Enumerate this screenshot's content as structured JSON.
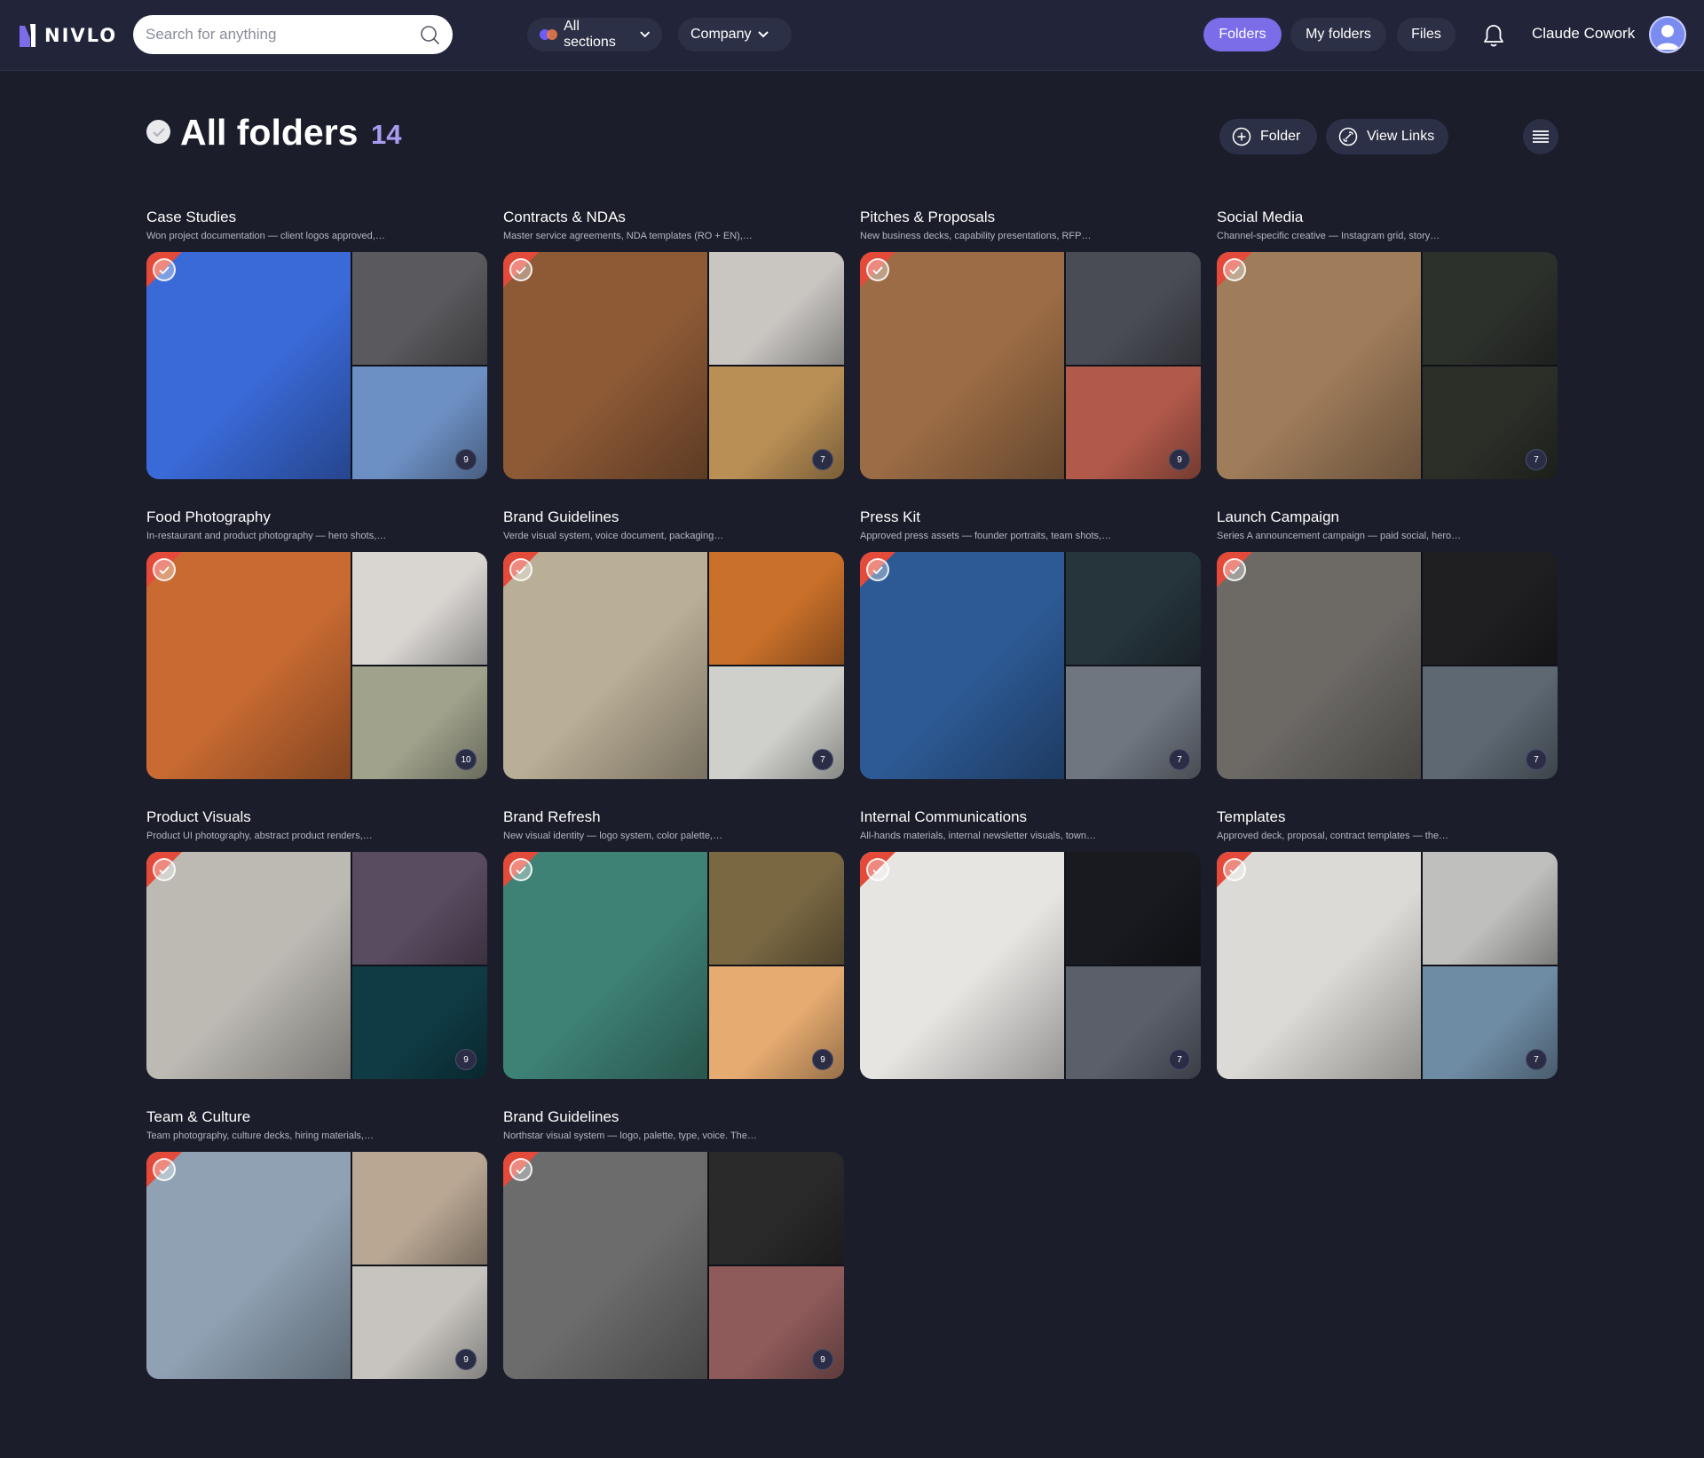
{
  "brand": {
    "name": "NIVLO"
  },
  "search": {
    "placeholder": "Search for anything"
  },
  "filters": {
    "sections": "All sections",
    "company": "Company"
  },
  "nav": {
    "folders": "Folders",
    "my_folders": "My folders",
    "files": "Files"
  },
  "user": {
    "name": "Claude Cowork"
  },
  "page": {
    "title": "All folders",
    "count": "14"
  },
  "actions": {
    "folder": "Folder",
    "view_links": "View Links"
  },
  "folders": [
    {
      "title": "Case Studies",
      "desc": "Won project documentation — client logos approved,…",
      "count": "9",
      "colors": [
        "#3a6ad8",
        "#5a5a5e",
        "#6d90c4"
      ]
    },
    {
      "title": "Contracts & NDAs",
      "desc": "Master service agreements, NDA templates (RO + EN),…",
      "count": "7",
      "colors": [
        "#8e5a36",
        "#c9c6c2",
        "#b98f55"
      ]
    },
    {
      "title": "Pitches & Proposals",
      "desc": "New business decks, capability presentations, RFP…",
      "count": "9",
      "colors": [
        "#9b6c45",
        "#4a4c55",
        "#b25a4a"
      ]
    },
    {
      "title": "Social Media",
      "desc": "Channel-specific creative — Instagram grid, story…",
      "count": "7",
      "colors": [
        "#9f7c5a",
        "#2d312c",
        "#2b2f28"
      ]
    },
    {
      "title": "Food Photography",
      "desc": "In-restaurant and product photography — hero shots,…",
      "count": "10",
      "colors": [
        "#c86a32",
        "#d9d6d2",
        "#a0a28c"
      ]
    },
    {
      "title": "Brand Guidelines",
      "desc": "Verde visual system, voice document, packaging…",
      "count": "7",
      "colors": [
        "#b9ae96",
        "#c9702a",
        "#cfcfcb"
      ]
    },
    {
      "title": "Press Kit",
      "desc": "Approved press assets — founder portraits, team shots,…",
      "count": "7",
      "colors": [
        "#2d5a95",
        "#26343c",
        "#6f7680"
      ]
    },
    {
      "title": "Launch Campaign",
      "desc": "Series A announcement campaign — paid social, hero…",
      "count": "7",
      "colors": [
        "#6d6a66",
        "#1f1f22",
        "#5d6872"
      ]
    },
    {
      "title": "Product Visuals",
      "desc": "Product UI photography, abstract product renders,…",
      "count": "9",
      "colors": [
        "#bdbab4",
        "#594b60",
        "#0f3b45"
      ]
    },
    {
      "title": "Brand Refresh",
      "desc": "New visual identity — logo system, color palette,…",
      "count": "9",
      "colors": [
        "#3e8275",
        "#7a6843",
        "#e6ab70"
      ]
    },
    {
      "title": "Internal Communications",
      "desc": "All-hands materials, internal newsletter visuals, town…",
      "count": "7",
      "colors": [
        "#e7e5e2",
        "#181a20",
        "#5a5f6a"
      ]
    },
    {
      "title": "Templates",
      "desc": "Approved deck, proposal, contract templates — the…",
      "count": "7",
      "colors": [
        "#dcdad6",
        "#bfbfbe",
        "#6f8ca5"
      ]
    },
    {
      "title": "Team & Culture",
      "desc": "Team photography, culture decks, hiring materials,…",
      "count": "9",
      "colors": [
        "#8fa1b3",
        "#b9a793",
        "#c7c4bf"
      ]
    },
    {
      "title": "Brand Guidelines",
      "desc": "Northstar visual system — logo, palette, type, voice. The…",
      "count": "9",
      "colors": [
        "#6c6c6c",
        "#2a2a2a",
        "#8f5a5a"
      ]
    }
  ]
}
